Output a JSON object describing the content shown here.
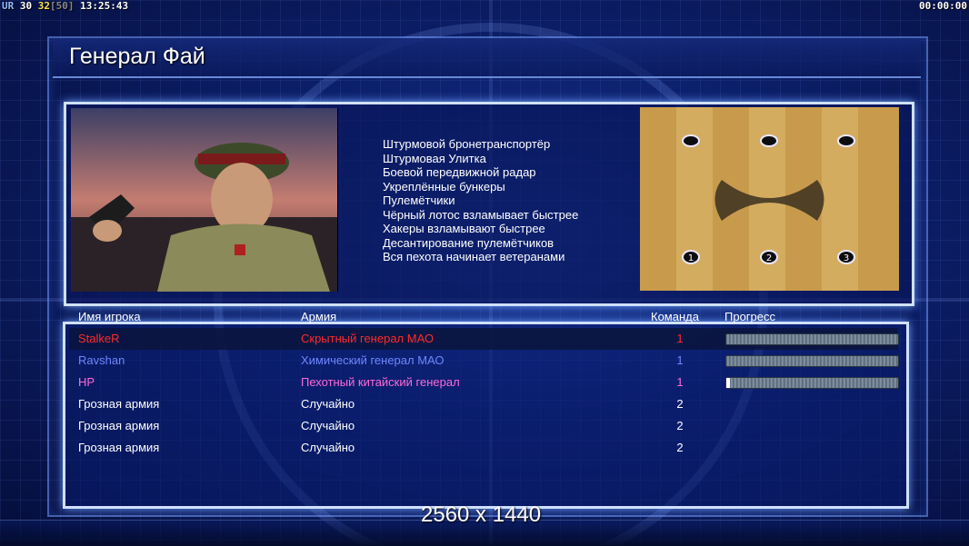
{
  "hud": {
    "ur_label": "UR",
    "fps_current": "30",
    "fps_target": "32",
    "fps_cap": "[50]",
    "clock": "13:25:43",
    "timer": "00:00:00"
  },
  "general": {
    "title": "Генерал Фай",
    "perks": [
      "Штурмовой бронетранспортёр",
      "Штурмовая Улитка",
      "Боевой передвижной радар",
      "Укреплённые бункеры",
      "Пулемётчики",
      "Чёрный лотос взламывает быстрее",
      "Хакеры взламывают быстрее",
      "Десантирование пулемётчиков",
      "Вся пехота начинает ветеранами"
    ]
  },
  "minimap": {
    "start_labels": [
      "1",
      "2",
      "3"
    ]
  },
  "players": {
    "headers": {
      "name": "Имя игрока",
      "army": "Армия",
      "team": "Команда",
      "progress": "Прогресс"
    },
    "rows": [
      {
        "name": "StalkeR",
        "army": "Скрытный генерал МАО",
        "team": "1",
        "color": "#ff2a2a",
        "progress": 0
      },
      {
        "name": "Ravshan",
        "army": "Химический генерал МАО",
        "team": "1",
        "color": "#6f86ff",
        "progress": 0
      },
      {
        "name": "HP",
        "army": "Пехотный китайский генерал",
        "team": "1",
        "color": "#ff6ad8",
        "progress": 2
      },
      {
        "name": "Грозная армия",
        "army": "Случайно",
        "team": "2",
        "color": "#ffffff",
        "progress": null
      },
      {
        "name": "Грозная армия",
        "army": "Случайно",
        "team": "2",
        "color": "#ffffff",
        "progress": null
      },
      {
        "name": "Грозная армия",
        "army": "Случайно",
        "team": "2",
        "color": "#ffffff",
        "progress": null
      }
    ]
  },
  "resolution": "2560 x 1440"
}
